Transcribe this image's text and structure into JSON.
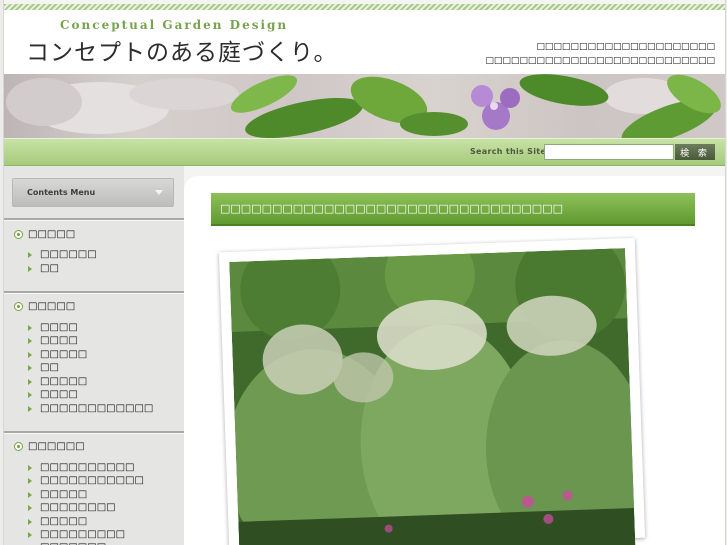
{
  "header": {
    "site_name_en": "Conceptual Garden Design",
    "site_title": "コンセプトのある庭づくり。",
    "tagline_lines": [
      "□□□□□□□□□□□□□□□□□□□□□",
      "□□□□□□□□□□□□□□□□□□□□□□□□□□□"
    ]
  },
  "search": {
    "label": "Search this Site",
    "placeholder": "",
    "button_label": "検 索"
  },
  "sidebar": {
    "menu_title": "Contents Menu",
    "sections": [
      {
        "title": "□□□□□",
        "items": [
          "□□□□□□",
          "□□"
        ]
      },
      {
        "title": "□□□□□",
        "items": [
          "□□□□",
          "□□□□",
          "□□□□□",
          "□□",
          "□□□□□",
          "□□□□",
          "□□□□□□□□□□□□"
        ]
      },
      {
        "title": "□□□□□□",
        "items": [
          "□□□□□□□□□□",
          "□□□□□□□□□□□",
          "□□□□□",
          "□□□□□□□□",
          "□□□□□",
          "□□□□□□□□□",
          "□□□□□□□"
        ]
      }
    ]
  },
  "main": {
    "entry_title": "□□□□□□□□□□□□□□□□□□□□□□□□□□□□□□□□□"
  },
  "colors": {
    "accent_green": "#6ea43c",
    "title_bar_green": "#7db14a",
    "search_bar_green": "#b7d892"
  }
}
